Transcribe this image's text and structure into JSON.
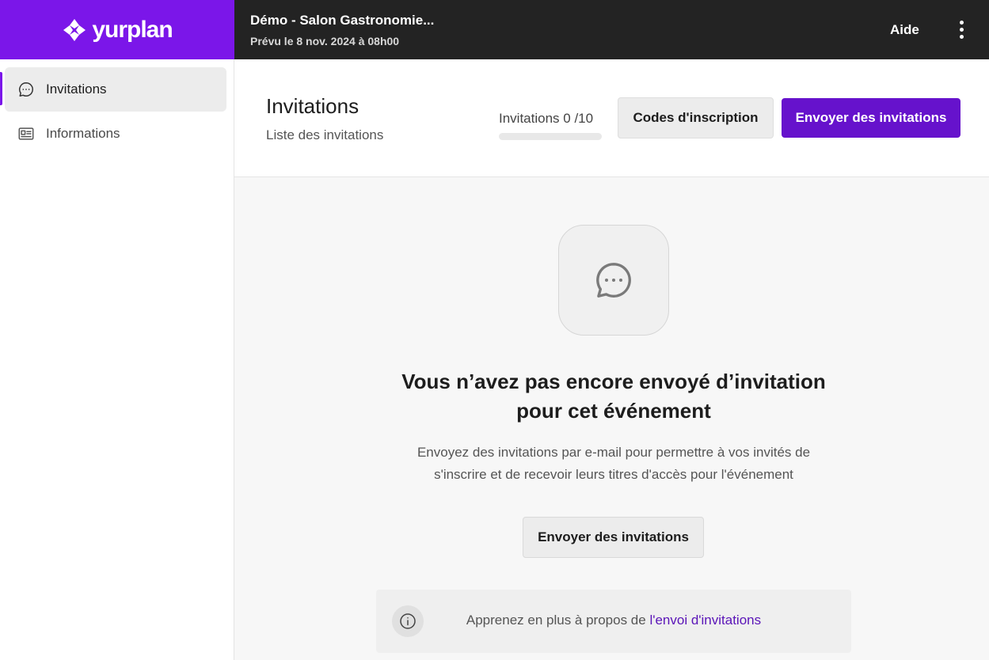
{
  "brand": {
    "name": "yurplan",
    "color": "#7b16e9"
  },
  "event": {
    "title": "Démo - Salon Gastronomie...",
    "date": "Prévu le 8 nov. 2024 à 08h00"
  },
  "topbar": {
    "help_label": "Aide",
    "more_icon": "more-vertical-icon"
  },
  "sidebar": {
    "items": [
      {
        "label": "Invitations",
        "icon": "chat-bubble-icon",
        "active": true
      },
      {
        "label": "Informations",
        "icon": "id-card-icon",
        "active": false
      }
    ]
  },
  "header": {
    "title": "Invitations",
    "subtitle": "Liste des invitations",
    "quota_label": "Invitations 0 /10",
    "quota_progress": 0,
    "codes_button": "Codes d'inscription",
    "send_button": "Envoyer des invitations",
    "accent": "#6612cc"
  },
  "empty_state": {
    "icon": "chat-bubble-icon",
    "title_line1": "Vous n’avez pas encore envoyé d’invitation",
    "title_line2": "pour cet événement",
    "desc_line1": "Envoyez des invitations par e-mail pour permettre à vos invités de",
    "desc_line2": "s'inscrire et de recevoir leurs titres d'accès pour l'événement",
    "button": "Envoyer des invitations"
  },
  "info": {
    "icon": "info-icon",
    "text": "Apprenez en plus à propos de ",
    "link": "l'envoi d'invitations"
  }
}
